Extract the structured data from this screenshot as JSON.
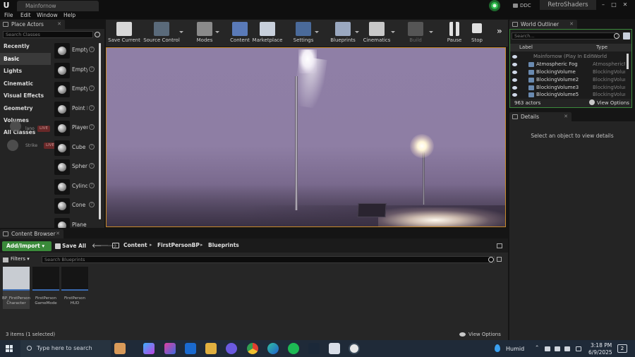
{
  "window": {
    "logo_text": "U",
    "doc_tab": "Mainfornow",
    "ddc_label": "DDC",
    "project_name": "RetroShaders",
    "minimize": "–",
    "maximize": "□",
    "close": "✕"
  },
  "menu": [
    "File",
    "Edit",
    "Window",
    "Help"
  ],
  "place_actors": {
    "tab_label": "Place Actors",
    "search_placeholder": "Search Classes",
    "categories": [
      "Recently Placed",
      "Basic",
      "Lights",
      "Cinematic",
      "Visual Effects",
      "Geometry",
      "Volumes",
      "All Classes"
    ],
    "active_category": "Basic",
    "actors": [
      "Empty Actor",
      "Empty Character",
      "Empty Pawn",
      "Point Light",
      "Player Start",
      "Cube",
      "Sphere",
      "Cylinder",
      "Cone",
      "Plane"
    ],
    "overlay": [
      {
        "name": "lano",
        "badge": "LIVE"
      },
      {
        "name": "Strike",
        "badge": "LIVE"
      }
    ]
  },
  "toolbar": {
    "buttons": [
      "Save Current",
      "Source Control",
      "Modes",
      "Content",
      "Marketplace",
      "Settings",
      "Blueprints",
      "Cinematics",
      "Build",
      "Pause",
      "Stop"
    ],
    "more": "»"
  },
  "outliner": {
    "tab_label": "World Outliner",
    "search_placeholder": "Search...",
    "col_label": "Label",
    "col_type": "Type",
    "rows": [
      {
        "name": "Mainfornow (Play In Editor)",
        "type": "World"
      },
      {
        "name": "Atmospheric Fog",
        "type": "AtmosphericFog"
      },
      {
        "name": "BlockingVolume",
        "type": "BlockingVolume"
      },
      {
        "name": "BlockingVolume2",
        "type": "BlockingVolume"
      },
      {
        "name": "BlockingVolume3",
        "type": "BlockingVolume"
      },
      {
        "name": "BlockingVolume5",
        "type": "BlockingVolume"
      }
    ],
    "actor_count": "963 actors",
    "view_options": "View Options"
  },
  "details": {
    "tab_label": "Details",
    "message": "Select an object to view details"
  },
  "content_browser": {
    "tab_label": "Content Browser",
    "add_import": "Add/Import",
    "save_all": "Save All",
    "breadcrumb": [
      "Content",
      "FirstPersonBP",
      "Blueprints"
    ],
    "filters": "Filters",
    "search_placeholder": "Search Blueprints",
    "assets": [
      {
        "line1": "BP_FirstPerson",
        "line2": "Character"
      },
      {
        "line1": "FirstPerson",
        "line2": "GameMode"
      },
      {
        "line1": "FirstPerson",
        "line2": "HUD"
      }
    ],
    "status": "3 items (1 selected)",
    "view_options": "View Options"
  },
  "taskbar": {
    "search_placeholder": "Type here to search",
    "weather": "Humid",
    "time": "3:18 PM",
    "date": "6/9/2025",
    "notifications": "2"
  },
  "colors": {
    "accent_green": "#3a8a3a",
    "viewport_border": "#c88a2a",
    "outliner_border": "#3c8a3c"
  }
}
